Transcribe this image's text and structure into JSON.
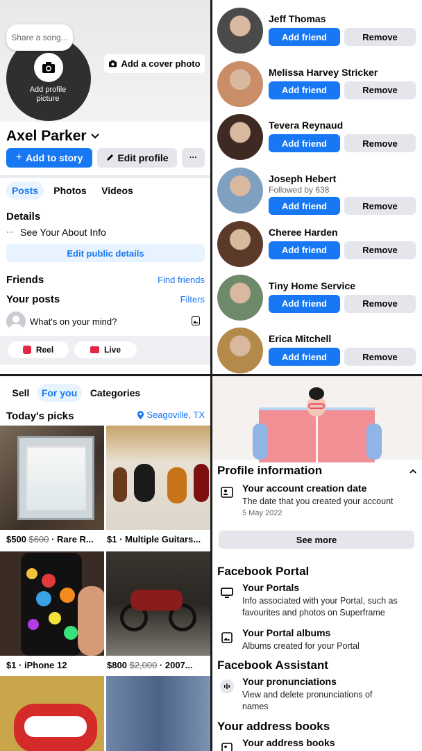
{
  "profile": {
    "song_prompt": "Share a song...",
    "add_picture_label": "Add profile picture",
    "add_cover_label": "Add a cover photo",
    "name": "Axel Parker",
    "add_story_label": "Add to story",
    "edit_profile_label": "Edit profile",
    "more_label": "···",
    "tabs": [
      {
        "label": "Posts"
      },
      {
        "label": "Photos"
      },
      {
        "label": "Videos"
      }
    ],
    "details_heading": "Details",
    "about_info": "See Your About Info",
    "edit_details_label": "Edit public details",
    "friends_heading": "Friends",
    "find_friends_label": "Find friends",
    "your_posts_heading": "Your posts",
    "filters_label": "Filters",
    "composer_placeholder": "What's on your mind?",
    "reel_label": "Reel",
    "live_label": "Live"
  },
  "friend_requests": {
    "add_label": "Add friend",
    "remove_label": "Remove",
    "people": [
      {
        "name": "Jeff Thomas",
        "sub": ""
      },
      {
        "name": "Melissa Harvey Stricker",
        "sub": ""
      },
      {
        "name": "Tevera Reynaud",
        "sub": ""
      },
      {
        "name": "Joseph Hebert",
        "sub": "Followed by 638"
      },
      {
        "name": "Cheree Harden",
        "sub": ""
      },
      {
        "name": "Tiny Home Service",
        "sub": ""
      },
      {
        "name": "Erica Mitchell",
        "sub": ""
      }
    ]
  },
  "marketplace": {
    "tabs": [
      {
        "label": "Sell"
      },
      {
        "label": "For you"
      },
      {
        "label": "Categories"
      }
    ],
    "heading": "Today's picks",
    "location": "Seagoville, TX",
    "items": [
      {
        "price": "$500",
        "old_price": "$600",
        "title": " · Rare R..."
      },
      {
        "price": "$1",
        "old_price": "",
        "title": " · Multiple Guitars..."
      },
      {
        "price": "$1",
        "old_price": "",
        "title": " · iPhone 12"
      },
      {
        "price": "$800",
        "old_price": "$2,000",
        "title": " · 2007..."
      }
    ]
  },
  "account_info": {
    "profile_info_heading": "Profile information",
    "creation_title": "Your account creation date",
    "creation_desc": "The date that you created your account",
    "creation_date": "5 May 2022",
    "see_more_label": "See more",
    "portal_heading": "Facebook Portal",
    "portals_title": "Your Portals",
    "portals_desc": "Info associated with your Portal, such as favourites and photos on Superframe",
    "albums_title": "Your Portal albums",
    "albums_desc": "Albums created for your Portal",
    "assistant_heading": "Facebook Assistant",
    "pron_title": "Your pronunciations",
    "pron_desc": "View and delete pronunciations of names",
    "address_heading": "Your address books",
    "address_title": "Your address books"
  },
  "colors": {
    "accent": "#1877f2",
    "button_grey": "#e4e6eb",
    "tab_active_bg": "#e7f3ff"
  }
}
